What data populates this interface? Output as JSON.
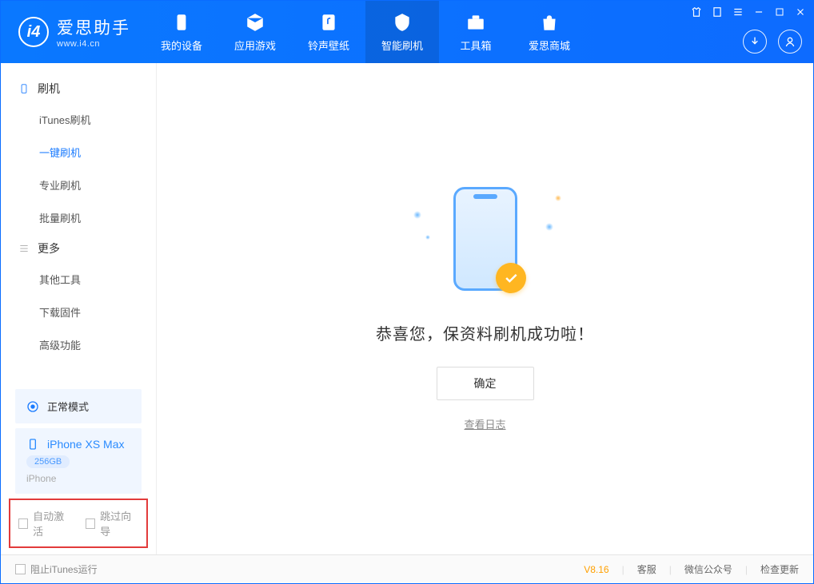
{
  "header": {
    "brand_cn": "爱思助手",
    "brand_en": "www.i4.cn",
    "tabs": [
      {
        "label": "我的设备"
      },
      {
        "label": "应用游戏"
      },
      {
        "label": "铃声壁纸"
      },
      {
        "label": "智能刷机"
      },
      {
        "label": "工具箱"
      },
      {
        "label": "爱思商城"
      }
    ]
  },
  "sidebar": {
    "group_flash": "刷机",
    "items_flash": [
      {
        "label": "iTunes刷机"
      },
      {
        "label": "一键刷机"
      },
      {
        "label": "专业刷机"
      },
      {
        "label": "批量刷机"
      }
    ],
    "group_more": "更多",
    "items_more": [
      {
        "label": "其他工具"
      },
      {
        "label": "下载固件"
      },
      {
        "label": "高级功能"
      }
    ],
    "status_mode": "正常模式",
    "device_name": "iPhone XS Max",
    "device_capacity": "256GB",
    "device_model": "iPhone",
    "opt_auto_activate": "自动激活",
    "opt_skip_guide": "跳过向导"
  },
  "main": {
    "success_text": "恭喜您，保资料刷机成功啦！",
    "ok_label": "确定",
    "view_log": "查看日志"
  },
  "footer": {
    "block_itunes": "阻止iTunes运行",
    "version": "V8.16",
    "kefu": "客服",
    "wechat": "微信公众号",
    "update": "检查更新"
  }
}
